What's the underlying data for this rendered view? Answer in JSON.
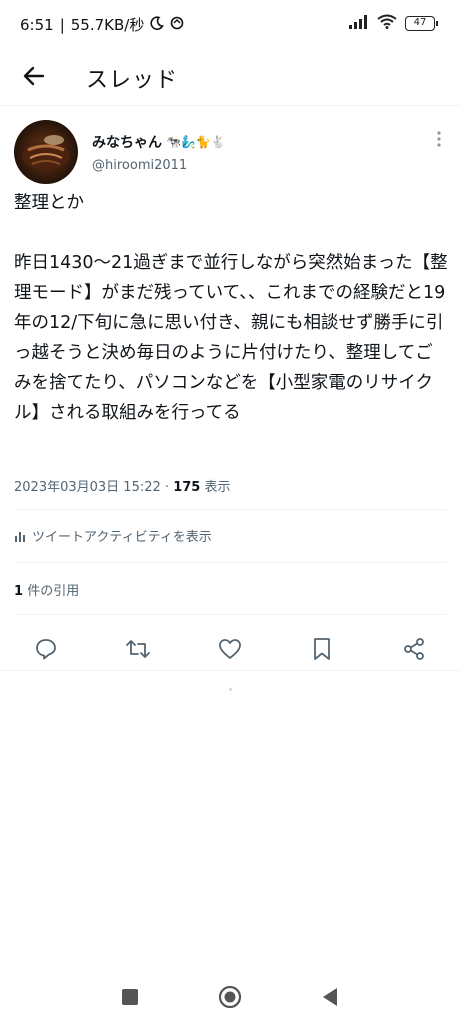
{
  "status_bar": {
    "time": "6:51",
    "network_speed": "55.7KB/秒",
    "battery_level": "47"
  },
  "header": {
    "title": "スレッド"
  },
  "tweet": {
    "user_name": "みなちゃん",
    "user_emojis": "🐄🧞‍♂️🐈🐇",
    "user_handle": "@hiroomi2011",
    "text": "整理とか\n\n昨日1430〜21過ぎまで並行しながら突然始まった【整理モード】がまだ残っていて、、これまでの経験だと19年の12/下旬に急に思い付き、親にも相談せず勝手に引っ越そうと決め毎日のように片付けたり、整理してごみを捨てたり、パソコンなどを【小型家電のリサイクル】される取組みを行ってる",
    "date": "2023年03月03日 15:22",
    "separator": "·",
    "views_count": "175",
    "views_label": "表示",
    "activity_label": "ツイートアクティビティを表示",
    "quote_count": "1",
    "quote_label": "件の引用"
  },
  "colors": {
    "text_primary": "#0f1419",
    "text_secondary": "#536471",
    "divider": "#eff3f4",
    "icon": "#536471"
  }
}
